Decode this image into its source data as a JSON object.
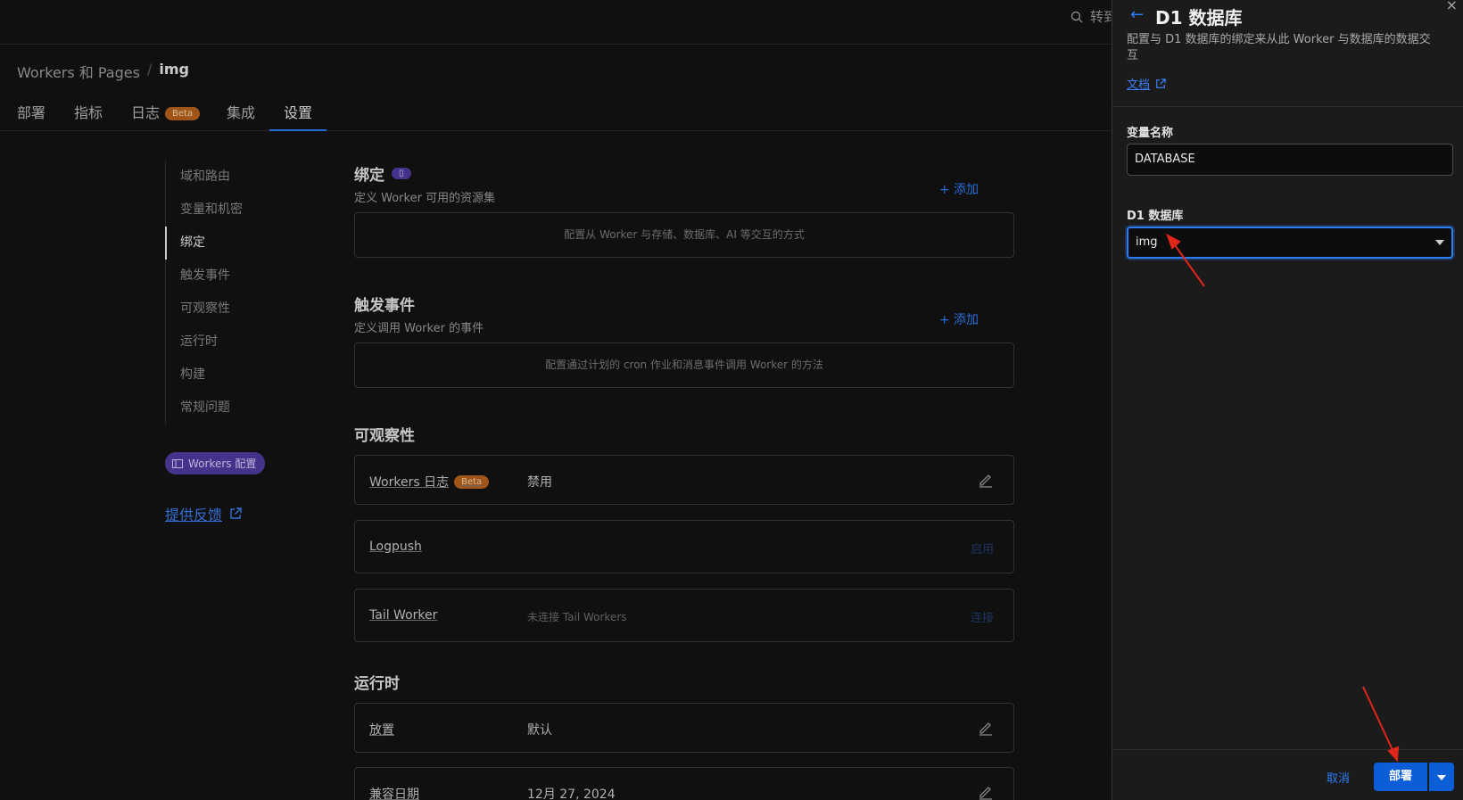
{
  "topbar": {
    "search_text": "转到"
  },
  "breadcrumb": {
    "parent": "Workers 和 Pages",
    "separator": "/",
    "current": "img"
  },
  "tabs": [
    {
      "label": "部署"
    },
    {
      "label": "指标"
    },
    {
      "label": "日志",
      "badge": "Beta"
    },
    {
      "label": "集成"
    },
    {
      "label": "设置"
    }
  ],
  "sidenav": {
    "items": [
      {
        "label": "域和路由"
      },
      {
        "label": "变量和机密"
      },
      {
        "label": "绑定"
      },
      {
        "label": "触发事件"
      },
      {
        "label": "可观察性"
      },
      {
        "label": "运行时"
      },
      {
        "label": "构建"
      },
      {
        "label": "常规问题"
      }
    ],
    "workers_config_label": "Workers 配置",
    "feedback_label": "提供反馈"
  },
  "bindings": {
    "title": "绑定",
    "subtitle": "定义 Worker 可用的资源集",
    "add_label": "+ 添加",
    "empty_text": "配置从 Worker 与存储、数据库、AI 等交互的方式"
  },
  "triggers": {
    "title": "触发事件",
    "subtitle": "定义调用 Worker 的事件",
    "add_label": "+ 添加",
    "empty_text": "配置通过计划的 cron 作业和消息事件调用 Worker 的方法"
  },
  "observability": {
    "title": "可观察性",
    "rows": [
      {
        "label": "Workers 日志",
        "badge": "Beta",
        "value": "禁用",
        "action": ""
      },
      {
        "label": "Logpush",
        "value": "",
        "action": "启用"
      },
      {
        "label": "Tail Worker",
        "value": "未连接 Tail Workers",
        "action": "连接"
      }
    ]
  },
  "runtime": {
    "title": "运行时",
    "rows": [
      {
        "label": "放置",
        "value": "默认"
      },
      {
        "label": "兼容日期",
        "value": "12月 27, 2024"
      }
    ]
  },
  "panel": {
    "title": "D1 数据库",
    "description": "配置与 D1 数据库的绑定来从此 Worker 与数据库的数据交互",
    "docs_label": "文档",
    "var_name_label": "变量名称",
    "var_name_value": "DATABASE",
    "db_label": "D1 数据库",
    "db_value": "img",
    "cancel_label": "取消",
    "deploy_label": "部署"
  },
  "colors": {
    "accent": "#2c7cf6",
    "background": "#131313",
    "panel": "#1b1b1b",
    "beta_badge": "#b8611d",
    "config_badge": "#4f3a9e",
    "annotation_arrow": "#e0261b"
  }
}
